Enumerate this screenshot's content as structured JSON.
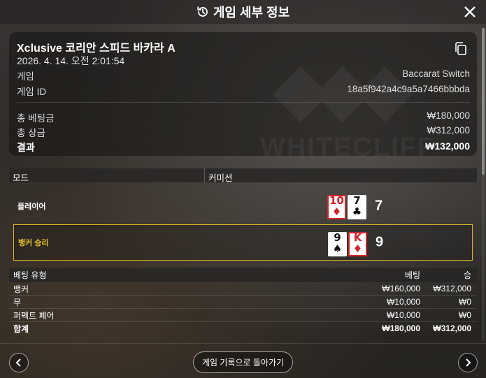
{
  "header": {
    "title": "게임 세부 정보",
    "history_icon": "history-icon",
    "close_icon": "close-icon"
  },
  "watermark": {
    "text": "WHITECLIFF"
  },
  "summary": {
    "game_name": "Xclusive 코리안 스피드 바카라 A",
    "datetime": "2026. 4. 14. 오전 2:01:54",
    "game_label": "게임",
    "game_value": "Baccarat Switch",
    "game_id_label": "게임 ID",
    "game_id_value": "18a5f942a4c9a5a7466bbbda",
    "total_bet_label": "총 베팅금",
    "total_bet_value": "₩180,000",
    "total_win_label": "총 상금",
    "total_win_value": "₩312,000",
    "result_label": "결과",
    "result_value": "₩132,000"
  },
  "mode": {
    "col1": "모드",
    "col2": "커미션"
  },
  "hands": {
    "player": {
      "label": "플레이어",
      "score": "7",
      "cards": [
        {
          "rank": "10",
          "suit": "♦",
          "color": "red"
        },
        {
          "rank": "7",
          "suit": "♣",
          "color": "black"
        }
      ]
    },
    "banker": {
      "label": "뱅커 승리",
      "score": "9",
      "cards": [
        {
          "rank": "9",
          "suit": "♠",
          "color": "black"
        },
        {
          "rank": "K",
          "suit": "♦",
          "color": "red"
        }
      ]
    }
  },
  "bets": {
    "headers": {
      "type": "베팅 유형",
      "bet": "베팅",
      "win": "승"
    },
    "rows": [
      {
        "type": "뱅커",
        "bet": "₩160,000",
        "win": "₩312,000"
      },
      {
        "type": "무",
        "bet": "₩10,000",
        "win": "₩0"
      },
      {
        "type": "퍼펙트 페어",
        "bet": "₩10,000",
        "win": "₩0"
      }
    ],
    "total": {
      "type": "합계",
      "bet": "₩180,000",
      "win": "₩312,000"
    }
  },
  "footer": {
    "back_label": "게임 기록으로 돌아가기"
  },
  "colors": {
    "accent_gold": "#d8b52a",
    "card_red": "#d6232a"
  }
}
